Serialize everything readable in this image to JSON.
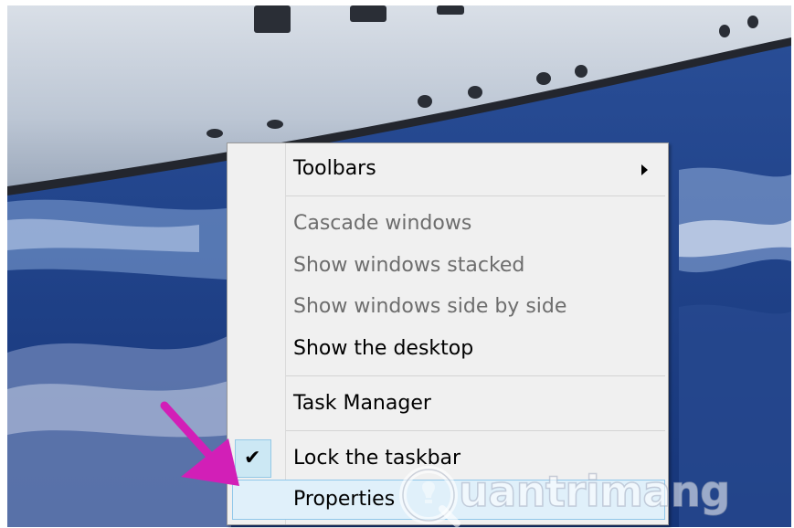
{
  "context_menu": {
    "items": [
      {
        "label": "Toolbars",
        "enabled": true,
        "has_submenu": true
      },
      {
        "label": "Cascade windows",
        "enabled": false
      },
      {
        "label": "Show windows stacked",
        "enabled": false
      },
      {
        "label": "Show windows side by side",
        "enabled": false
      },
      {
        "label": "Show the desktop",
        "enabled": true
      },
      {
        "label": "Task Manager",
        "enabled": true
      },
      {
        "label": "Lock the taskbar",
        "enabled": true,
        "checked": true
      },
      {
        "label": "Properties",
        "enabled": true,
        "highlighted": true
      }
    ]
  },
  "annotation": {
    "arrow_color": "#d21fb7"
  },
  "watermark": {
    "text": "uantrimang"
  },
  "colors": {
    "menu_bg": "#f0f0f0",
    "disabled_text": "#6d6d6d",
    "highlight_bg": "#e0f0fa",
    "highlight_border": "#8fc7ea",
    "sea": "#1d3f86",
    "hull": "#c9d1dc"
  }
}
